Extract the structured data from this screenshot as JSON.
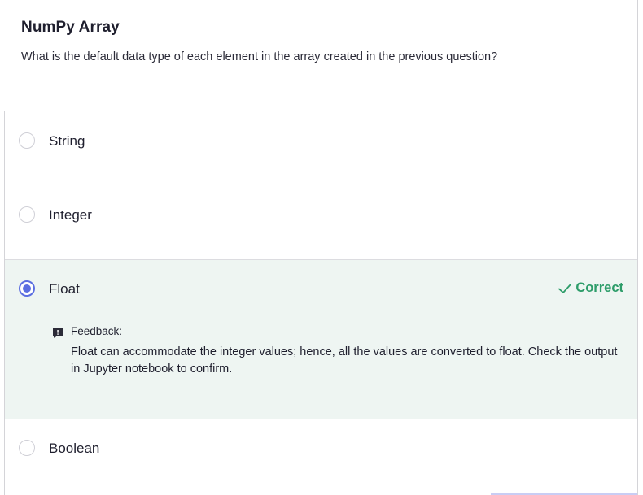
{
  "question": {
    "title": "NumPy Array",
    "prompt": "What is the default data type of each element in the array created in the previous question?"
  },
  "options": [
    {
      "label": "String",
      "selected": false
    },
    {
      "label": "Integer",
      "selected": false
    },
    {
      "label": "Float",
      "selected": true,
      "verdict": "Correct"
    },
    {
      "label": "Boolean",
      "selected": false
    }
  ],
  "feedback": {
    "heading": "Feedback:",
    "body": "Float can accommodate the integer values; hence, all the values are converted to float. Check the output in Jupyter notebook to confirm."
  },
  "colors": {
    "accent": "#5b6ee1",
    "correct": "#2e9d6a",
    "correct_bg": "#eef5f2"
  },
  "icons": {
    "check": "check-icon",
    "feedback": "feedback-icon"
  }
}
